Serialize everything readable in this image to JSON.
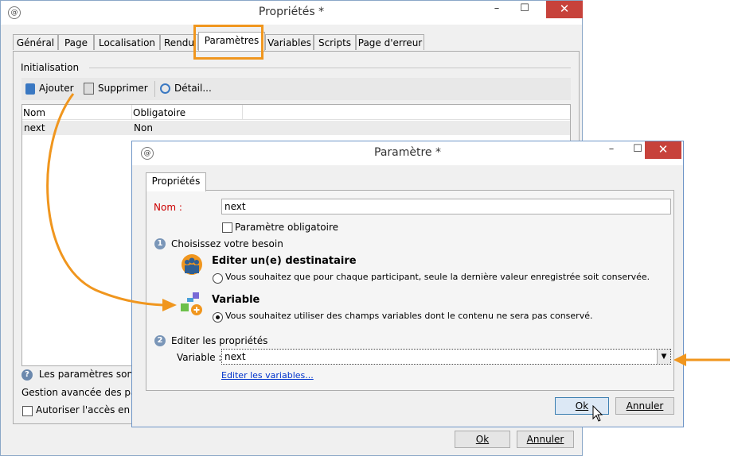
{
  "main_window": {
    "title": "Propriétés *",
    "tabs": [
      "Général",
      "Page",
      "Localisation",
      "Rendu",
      "Paramètres",
      "Variables",
      "Scripts",
      "Page d'erreur"
    ],
    "active_tab": "Paramètres",
    "section_title": "Initialisation",
    "toolbar": {
      "add": "Ajouter",
      "delete": "Supprimer",
      "detail": "Détail..."
    },
    "table": {
      "headers": [
        "Nom",
        "Obligatoire"
      ],
      "rows": [
        {
          "name": "next",
          "mandatory": "Non"
        }
      ]
    },
    "info_text": "Les paramètres sont pa",
    "advanced_text": "Gestion avancée des param",
    "access_checkbox": "Autoriser l'accès en écri",
    "ok": "Ok",
    "cancel": "Annuler"
  },
  "param_dialog": {
    "title": "Paramètre *",
    "tab": "Propriétés",
    "name_label": "Nom :",
    "name_value": "next",
    "mandatory_checkbox": "Paramètre obligatoire",
    "step1_num": "1",
    "step1": "Choisissez votre besoin",
    "option1_title": "Editer un(e) destinataire",
    "option1_desc": "Vous souhaitez que pour chaque participant, seule la dernière valeur enregistrée soit conservée.",
    "option2_title": "Variable",
    "option2_desc": "Vous souhaitez utiliser des champs variables dont le contenu ne sera pas conservé.",
    "selected_option": "Variable",
    "step2_num": "2",
    "step2": "Editer les propriétés",
    "variable_label": "Variable :",
    "variable_value": "next",
    "edit_variables_link": "Editer les variables...",
    "ok": "Ok",
    "cancel": "Annuler"
  },
  "colors": {
    "highlight": "#f0961e",
    "red_label": "#cc0000",
    "link": "#0033cc",
    "close_button": "#c7423b"
  },
  "window_controls": {
    "minimize": "–",
    "maximize": "☐",
    "close": "✕"
  }
}
